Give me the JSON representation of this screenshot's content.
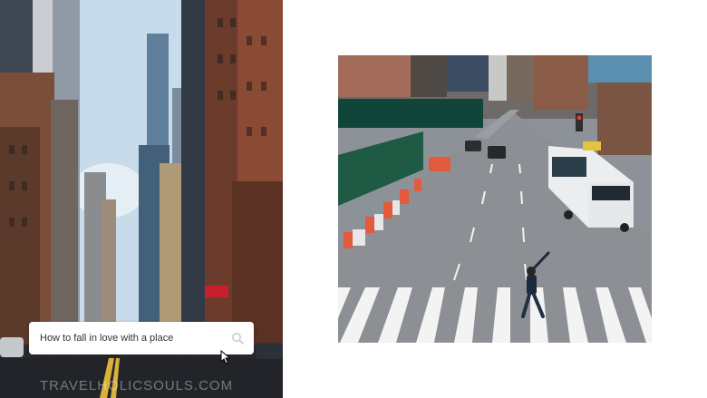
{
  "slide": {
    "left_image": {
      "alt": "New York street between skyscrapers"
    },
    "search": {
      "query": "How to fall in love with a place",
      "icon": "search-icon"
    },
    "watermark": "TRAVELHOLICSOULS.COM",
    "right_image": {
      "alt": "Person crossing a crosswalk on a New York avenue with a bus"
    }
  }
}
